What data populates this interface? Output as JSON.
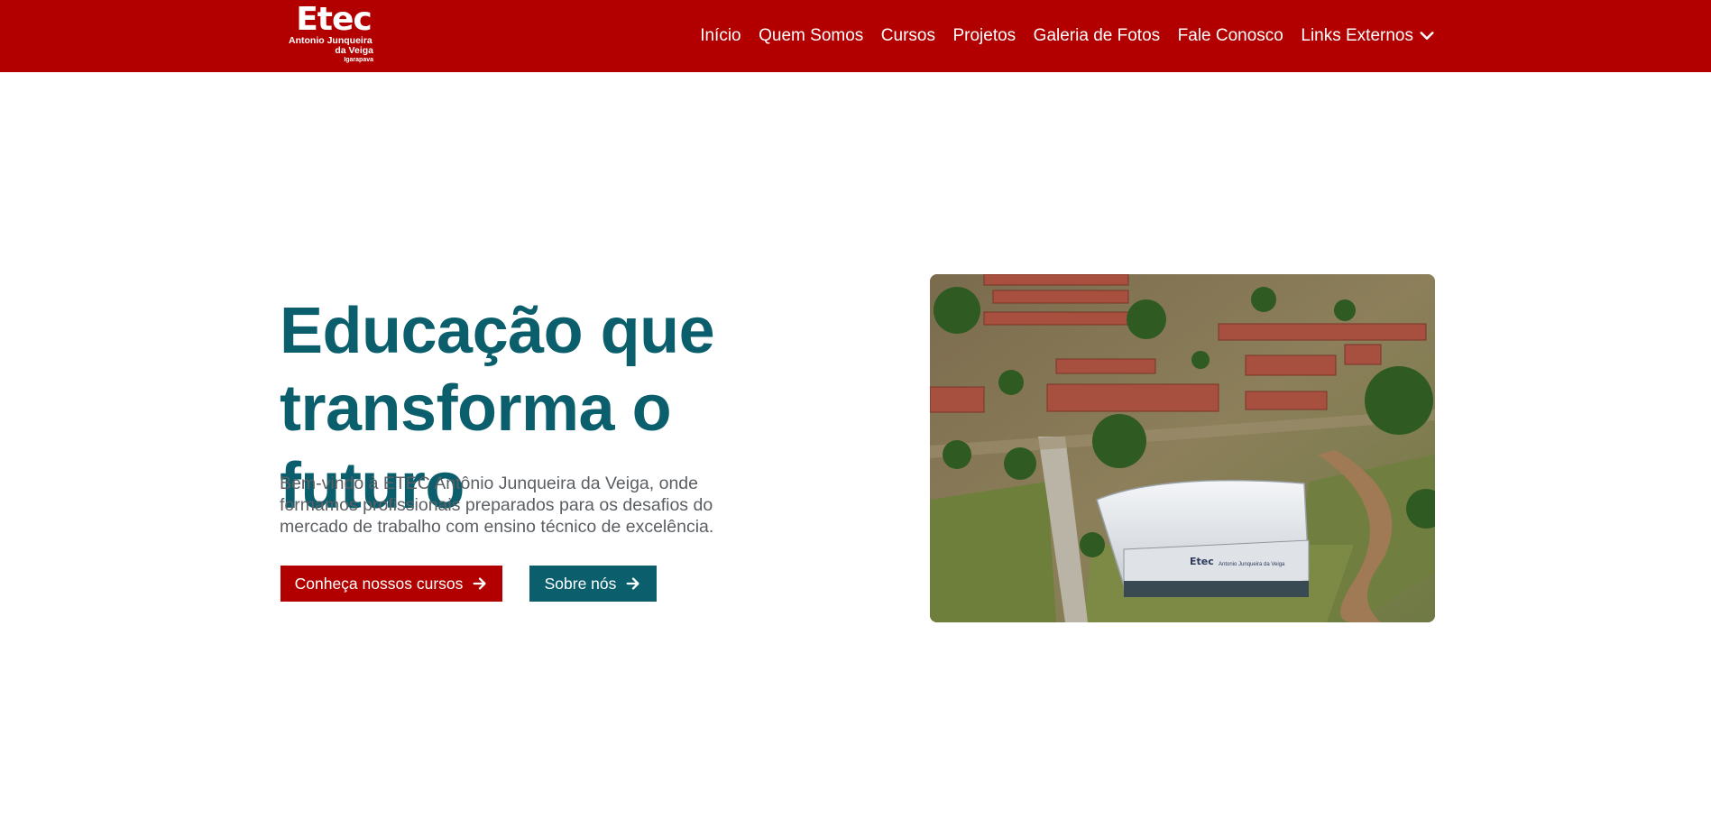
{
  "header": {
    "logo": {
      "brand": "Etec",
      "line1": "Antonio Junqueira",
      "line2": "da Veiga",
      "line3": "Igarapava"
    },
    "nav": [
      {
        "label": "Início"
      },
      {
        "label": "Quem Somos"
      },
      {
        "label": "Cursos"
      },
      {
        "label": "Projetos"
      },
      {
        "label": "Galeria de Fotos"
      },
      {
        "label": "Fale Conosco"
      },
      {
        "label": "Links Externos",
        "icon": "chevron-down-icon"
      }
    ]
  },
  "hero": {
    "title_line1": "Educação que",
    "title_line2": "transforma o futuro",
    "text": "Bem-vindo à ETEC Antônio Junqueira da Veiga, onde formamos profissionais preparados para os desafios do mercado de trabalho com ensino técnico de excelência.",
    "buttons": {
      "courses_label": "Conheça nossos cursos",
      "about_label": "Sobre nós",
      "icon": "arrow-right-icon"
    },
    "photo": {
      "building_sign_brand": "Etec",
      "building_sign_name": "Antonio Junqueira da Veiga"
    }
  },
  "colors": {
    "brand_red": "#b20000",
    "brand_teal": "#0b5f6d",
    "text_gray": "#5b5f63"
  }
}
